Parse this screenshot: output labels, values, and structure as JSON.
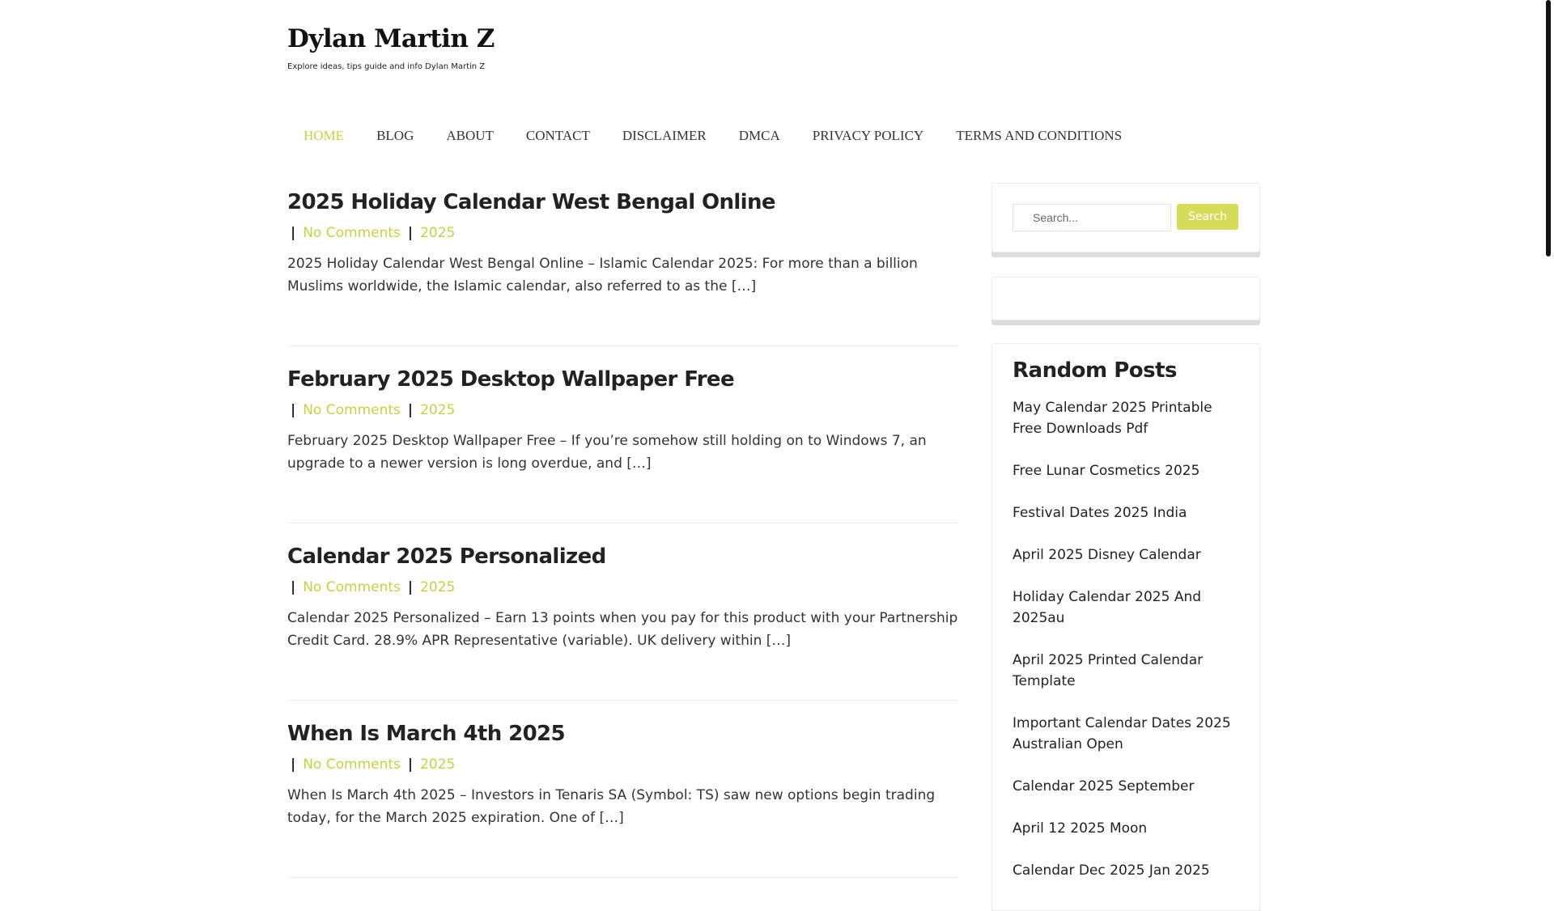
{
  "site": {
    "title": "Dylan Martin Z",
    "description": "Explore ideas, tips guide and info Dylan Martin Z"
  },
  "nav": {
    "items": [
      {
        "label": "HOME",
        "active": true
      },
      {
        "label": "BLOG"
      },
      {
        "label": "ABOUT"
      },
      {
        "label": "CONTACT"
      },
      {
        "label": "DISCLAIMER"
      },
      {
        "label": "DMCA"
      },
      {
        "label": "PRIVACY POLICY"
      },
      {
        "label": "TERMS AND CONDITIONS"
      }
    ]
  },
  "posts": [
    {
      "title": "2025 Holiday Calendar West Bengal Online",
      "comments": "No Comments",
      "category": "2025",
      "excerpt": "2025 Holiday Calendar West Bengal Online – Islamic Calendar 2025: For more than a billion Muslims worldwide, the Islamic calendar, also referred to as the […]"
    },
    {
      "title": "February 2025 Desktop Wallpaper Free",
      "comments": "No Comments",
      "category": "2025",
      "excerpt": "February 2025 Desktop Wallpaper Free – If you’re somehow still holding on to Windows 7, an upgrade to a newer version is long overdue, and […]"
    },
    {
      "title": "Calendar 2025 Personalized",
      "comments": "No Comments",
      "category": "2025",
      "excerpt": "Calendar 2025 Personalized – Earn 13 points when you pay for this product with your Partnership Credit Card. 28.9% APR Representative (variable). UK delivery within […]"
    },
    {
      "title": "When Is March 4th 2025",
      "comments": "No Comments",
      "category": "2025",
      "excerpt": "When Is March 4th 2025 – Investors in Tenaris SA (Symbol: TS) saw new options begin trading today, for the March 2025 expiration. One of […]"
    }
  ],
  "sidebar": {
    "search": {
      "placeholder": "Search...",
      "button_label": "Search"
    },
    "random_posts": {
      "title": "Random Posts",
      "items": [
        "May Calendar 2025 Printable Free Downloads Pdf",
        "Free Lunar Cosmetics 2025",
        "Festival Dates 2025 India",
        "April 2025 Disney Calendar",
        "Holiday Calendar 2025 And 2025au",
        "April 2025 Printed Calendar Template",
        "Important Calendar Dates 2025 Australian Open",
        "Calendar 2025 September",
        "April 12 2025 Moon",
        "Calendar Dec 2025 Jan 2025"
      ]
    }
  },
  "colors": {
    "accent": "#c9d13f",
    "button": "#d4dc5a",
    "text": "#222222",
    "divider": "#ececec"
  }
}
